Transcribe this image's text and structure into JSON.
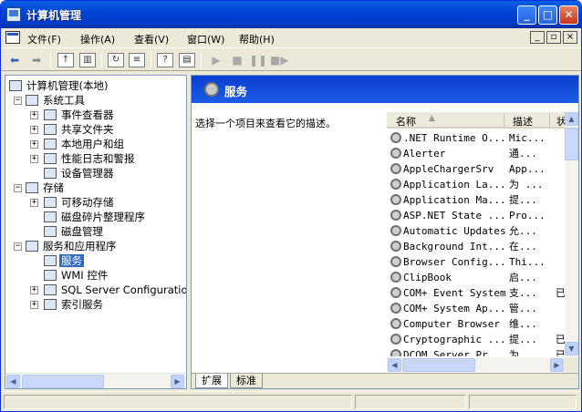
{
  "window": {
    "title": "计算机管理"
  },
  "menu": [
    {
      "label": "文件(F)"
    },
    {
      "label": "操作(A)"
    },
    {
      "label": "查看(V)"
    },
    {
      "label": "窗口(W)"
    },
    {
      "label": "帮助(H)"
    }
  ],
  "tree": {
    "root": "计算机管理(本地)",
    "nodes": [
      {
        "label": "系统工具"
      },
      {
        "label": "事件查看器"
      },
      {
        "label": "共享文件夹"
      },
      {
        "label": "本地用户和组"
      },
      {
        "label": "性能日志和警报"
      },
      {
        "label": "设备管理器"
      },
      {
        "label": "存储"
      },
      {
        "label": "可移动存储"
      },
      {
        "label": "磁盘碎片整理程序"
      },
      {
        "label": "磁盘管理"
      },
      {
        "label": "服务和应用程序"
      },
      {
        "label": "服务"
      },
      {
        "label": "WMI 控件"
      },
      {
        "label": "SQL Server Configuratio"
      },
      {
        "label": "索引服务"
      }
    ]
  },
  "right": {
    "title": "服务",
    "description": "选择一个项目来查看它的描述。",
    "columns": {
      "name": "名称",
      "desc": "描述",
      "status": "状"
    },
    "services": [
      {
        "name": ".NET Runtime O...",
        "desc": "Mic...",
        "status": ""
      },
      {
        "name": "Alerter",
        "desc": "通...",
        "status": ""
      },
      {
        "name": "AppleChargerSrv",
        "desc": "App...",
        "status": ""
      },
      {
        "name": "Application La...",
        "desc": "为 ...",
        "status": ""
      },
      {
        "name": "Application Ma...",
        "desc": "提...",
        "status": ""
      },
      {
        "name": "ASP.NET State ...",
        "desc": "Pro...",
        "status": ""
      },
      {
        "name": "Automatic Updates",
        "desc": "允...",
        "status": ""
      },
      {
        "name": "Background Int...",
        "desc": "在...",
        "status": ""
      },
      {
        "name": "Browser Config...",
        "desc": "Thi...",
        "status": ""
      },
      {
        "name": "ClipBook",
        "desc": "启...",
        "status": ""
      },
      {
        "name": "COM+ Event System",
        "desc": "支...",
        "status": "已"
      },
      {
        "name": "COM+ System Ap...",
        "desc": "管...",
        "status": ""
      },
      {
        "name": "Computer Browser",
        "desc": "维...",
        "status": ""
      },
      {
        "name": "Cryptographic ...",
        "desc": "提...",
        "status": "已"
      },
      {
        "name": "DCOM Server Pr...",
        "desc": "为 ...",
        "status": "已"
      }
    ],
    "tabs": [
      {
        "label": "扩展"
      },
      {
        "label": "标准"
      }
    ]
  }
}
